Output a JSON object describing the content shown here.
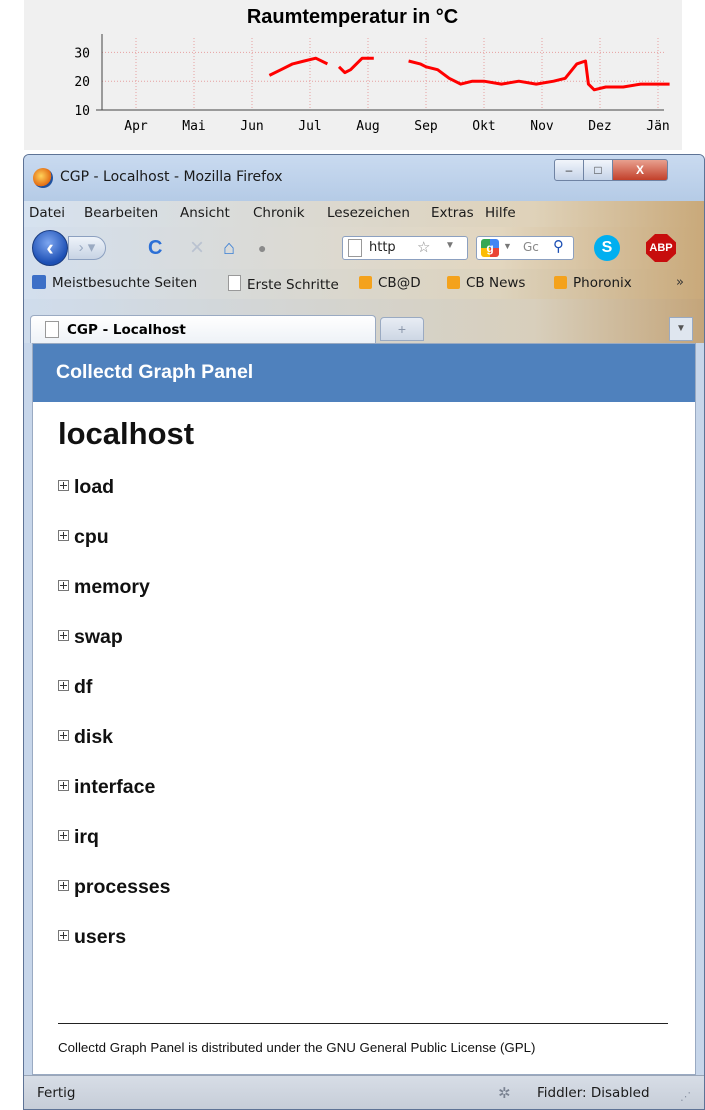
{
  "chart": {
    "title": "Raumtemperatur in °C",
    "y_ticks": [
      "30",
      "20",
      "10"
    ],
    "x_ticks": [
      "Apr",
      "Mai",
      "Jun",
      "Jul",
      "Aug",
      "Sep",
      "Okt",
      "Nov",
      "Dez",
      "Jän"
    ],
    "line_color": "#ff0000"
  },
  "chart_data": {
    "type": "line",
    "title": "Raumtemperatur in °C",
    "xlabel": "",
    "ylabel": "",
    "categories": [
      "Apr",
      "Mai",
      "Jun",
      "Jul",
      "Aug",
      "Sep",
      "Okt",
      "Nov",
      "Dez",
      "Jän"
    ],
    "ylim": [
      10,
      35
    ],
    "grid": true,
    "series": [
      {
        "values_by_month_index": [
          [
            2.3,
            22
          ],
          [
            2.5,
            24
          ],
          [
            2.7,
            26
          ],
          [
            2.9,
            27
          ],
          [
            3.1,
            28
          ],
          [
            3.3,
            26
          ],
          [
            3.5,
            25
          ],
          [
            3.6,
            23
          ],
          [
            3.7,
            24
          ],
          [
            3.9,
            28
          ],
          [
            4.1,
            28
          ],
          [
            4.7,
            27
          ],
          [
            4.9,
            26
          ],
          [
            5.0,
            25
          ],
          [
            5.2,
            24
          ],
          [
            5.4,
            21
          ],
          [
            5.6,
            19
          ],
          [
            5.8,
            20
          ],
          [
            6.0,
            20
          ],
          [
            6.3,
            19
          ],
          [
            6.6,
            20
          ],
          [
            6.9,
            19
          ],
          [
            7.2,
            20
          ],
          [
            7.4,
            21
          ],
          [
            7.6,
            26
          ],
          [
            7.75,
            27
          ],
          [
            7.8,
            19
          ],
          [
            7.9,
            17
          ],
          [
            8.1,
            18
          ],
          [
            8.4,
            18
          ],
          [
            8.7,
            19
          ],
          [
            9.0,
            19
          ],
          [
            9.2,
            19
          ]
        ]
      }
    ]
  },
  "window": {
    "title": "CGP - Localhost - Mozilla Firefox",
    "controls": {
      "minimize": "–",
      "maximize": "□",
      "close": "X"
    }
  },
  "menu": [
    "Datei",
    "Bearbeiten",
    "Ansicht",
    "Chronik",
    "Lesezeichen",
    "Extras",
    "Hilfe"
  ],
  "nav": {
    "url_text": "http",
    "search_placeholder": "Gc",
    "icons": [
      "back-icon",
      "forward-icon",
      "reload-icon",
      "stop-icon",
      "home-icon",
      "addon-icon",
      "skype-icon",
      "adblock-icon"
    ]
  },
  "bookmarks": [
    "Meistbesuchte Seiten",
    "Erste Schritte",
    "CB@D",
    "CB News",
    "Phoronix"
  ],
  "bookmarks_more": "»",
  "tab": {
    "label": "CGP - Localhost",
    "new_tab": "+"
  },
  "page": {
    "header": "Collectd Graph Panel",
    "host": "localhost",
    "plugins": [
      "load",
      "cpu",
      "memory",
      "swap",
      "df",
      "disk",
      "interface",
      "irq",
      "processes",
      "users"
    ],
    "footer": "Collectd Graph Panel is distributed under the GNU General Public License (GPL)"
  },
  "status": {
    "text": "Fertig",
    "fiddler": "Fiddler: Disabled"
  },
  "colors": {
    "header_bg": "#4f81bd",
    "page_bg": "#ffffff",
    "window_frame": "#c7d6ea"
  }
}
